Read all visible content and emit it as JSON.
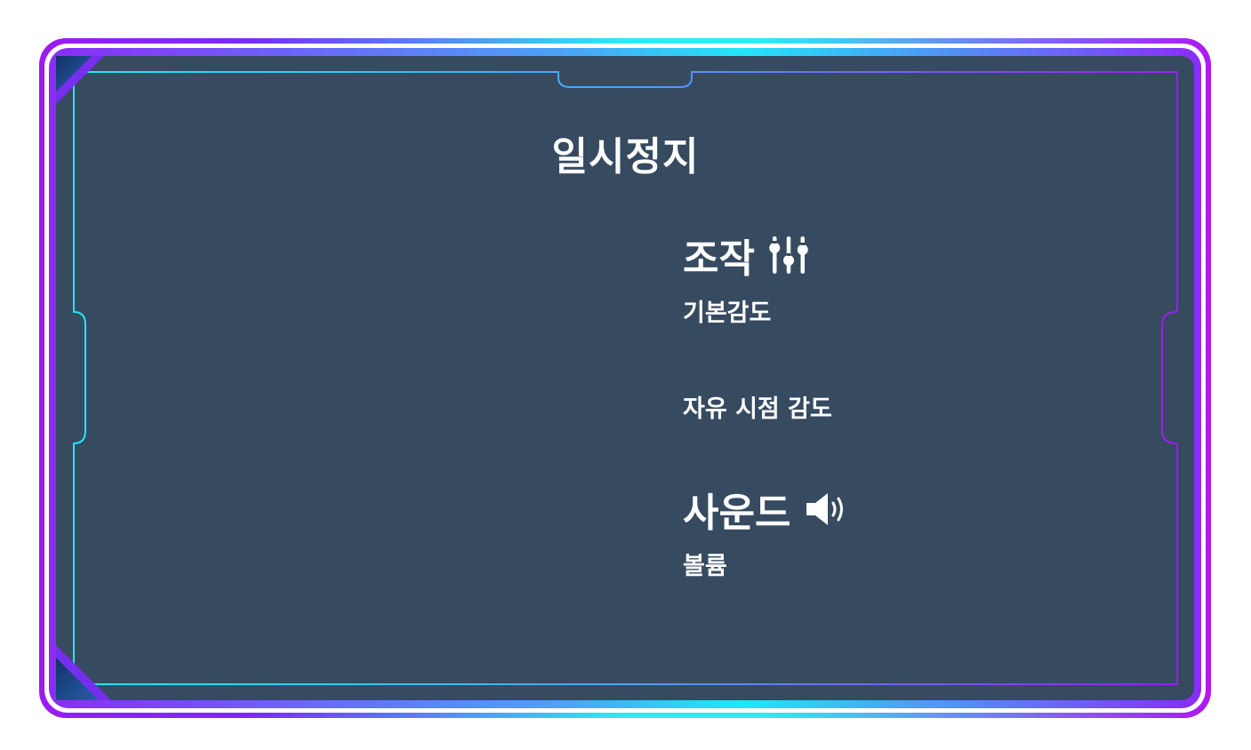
{
  "pause_menu": {
    "title": "일시정지",
    "controls": {
      "heading": "조작",
      "icon": "sliders-icon",
      "items": [
        "기본감도",
        "자유 시점 감도"
      ]
    },
    "sound": {
      "heading": "사운드",
      "icon": "speaker-icon",
      "items": [
        "볼륨"
      ]
    }
  },
  "colors": {
    "panel": "#364a60",
    "accent_cyan": "#22e6f7",
    "accent_purple": "#9a1cf0",
    "text": "#ffffff"
  }
}
